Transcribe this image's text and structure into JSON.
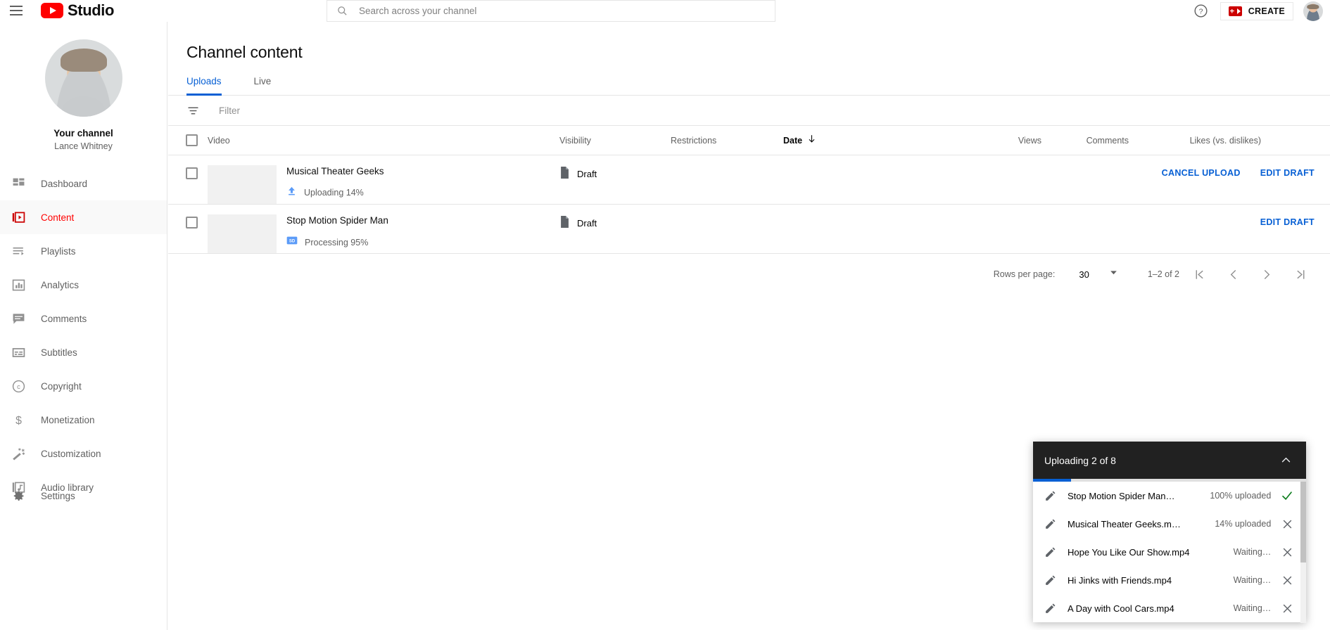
{
  "topbar": {
    "menu_icon": "hamburger-icon",
    "logo_text": "Studio",
    "search_placeholder": "Search across your channel",
    "search_value": "",
    "help_icon": "question-mark-circle-icon",
    "create_label": "CREATE",
    "avatar_label": "account-avatar"
  },
  "sidebar": {
    "channel_title": "Your channel",
    "channel_owner": "Lance Whitney",
    "items": [
      {
        "label": "Dashboard",
        "icon": "dashboard-icon",
        "active": false
      },
      {
        "label": "Content",
        "icon": "content-video-icon",
        "active": true
      },
      {
        "label": "Playlists",
        "icon": "playlist-icon",
        "active": false
      },
      {
        "label": "Analytics",
        "icon": "analytics-bar-icon",
        "active": false
      },
      {
        "label": "Comments",
        "icon": "comment-icon",
        "active": false
      },
      {
        "label": "Subtitles",
        "icon": "subtitles-icon",
        "active": false
      },
      {
        "label": "Copyright",
        "icon": "copyright-icon",
        "active": false
      },
      {
        "label": "Monetization",
        "icon": "dollar-icon",
        "active": false
      },
      {
        "label": "Customization",
        "icon": "magic-wand-icon",
        "active": false
      },
      {
        "label": "Audio library",
        "icon": "audio-note-icon",
        "active": false
      }
    ],
    "settings_label": "Settings",
    "settings_icon": "gear-icon"
  },
  "main": {
    "page_title": "Channel content",
    "tabs": [
      {
        "label": "Uploads",
        "active": true
      },
      {
        "label": "Live",
        "active": false
      }
    ],
    "filter": {
      "icon": "filter-icon",
      "placeholder": "Filter",
      "value": ""
    },
    "table": {
      "columns": [
        "Video",
        "Visibility",
        "Restrictions",
        "Date",
        "Views",
        "Comments",
        "Likes (vs. dislikes)"
      ],
      "sort_column": "Date",
      "sort_direction": "descending",
      "rows": [
        {
          "selected": false,
          "title": "Musical Theater Geeks",
          "status_icon": "upload-arrow-icon",
          "status_text": "Uploading 14%",
          "visibility_icon": "draft-document-icon",
          "visibility": "Draft",
          "restrictions": "",
          "date": "",
          "views": "",
          "comments": "",
          "likes": "",
          "actions": [
            "CANCEL UPLOAD",
            "EDIT DRAFT"
          ]
        },
        {
          "selected": false,
          "title": "Stop Motion Spider Man",
          "status_icon": "sd-badge-icon",
          "status_text": "Processing 95%",
          "visibility_icon": "draft-document-icon",
          "visibility": "Draft",
          "restrictions": "",
          "date": "",
          "views": "",
          "comments": "",
          "likes": "",
          "actions": [
            "EDIT DRAFT"
          ]
        }
      ]
    },
    "pager": {
      "rows_per_page_label": "Rows per page:",
      "rows_per_page_value": "30",
      "range_label": "1–2 of 2",
      "first_icon": "first-page-icon",
      "prev_icon": "previous-page-icon",
      "next_icon": "next-page-icon",
      "last_icon": "last-page-icon"
    }
  },
  "upload_panel": {
    "title": "Uploading 2 of 8",
    "collapse_icon": "chevron-up-icon",
    "progress_percent": 14,
    "items": [
      {
        "name": "Stop Motion Spider Man…",
        "status": "100% uploaded",
        "action_icon": "check-icon",
        "action_color": "#0d7d1e"
      },
      {
        "name": "Musical Theater Geeks.m…",
        "status": "14% uploaded",
        "action_icon": "close-icon",
        "action_color": "#606060"
      },
      {
        "name": "Hope You Like Our Show.mp4",
        "status": "Waiting…",
        "action_icon": "close-icon",
        "action_color": "#606060"
      },
      {
        "name": "Hi Jinks with Friends.mp4",
        "status": "Waiting…",
        "action_icon": "close-icon",
        "action_color": "#606060"
      },
      {
        "name": "A Day with Cool Cars.mp4",
        "status": "Waiting…",
        "action_icon": "close-icon",
        "action_color": "#606060"
      }
    ]
  },
  "colors": {
    "brand_red": "#ff0000",
    "link_blue": "#065fd4",
    "panel_dark": "#212121",
    "success_green": "#0d7d1e",
    "text_secondary": "#606060"
  }
}
